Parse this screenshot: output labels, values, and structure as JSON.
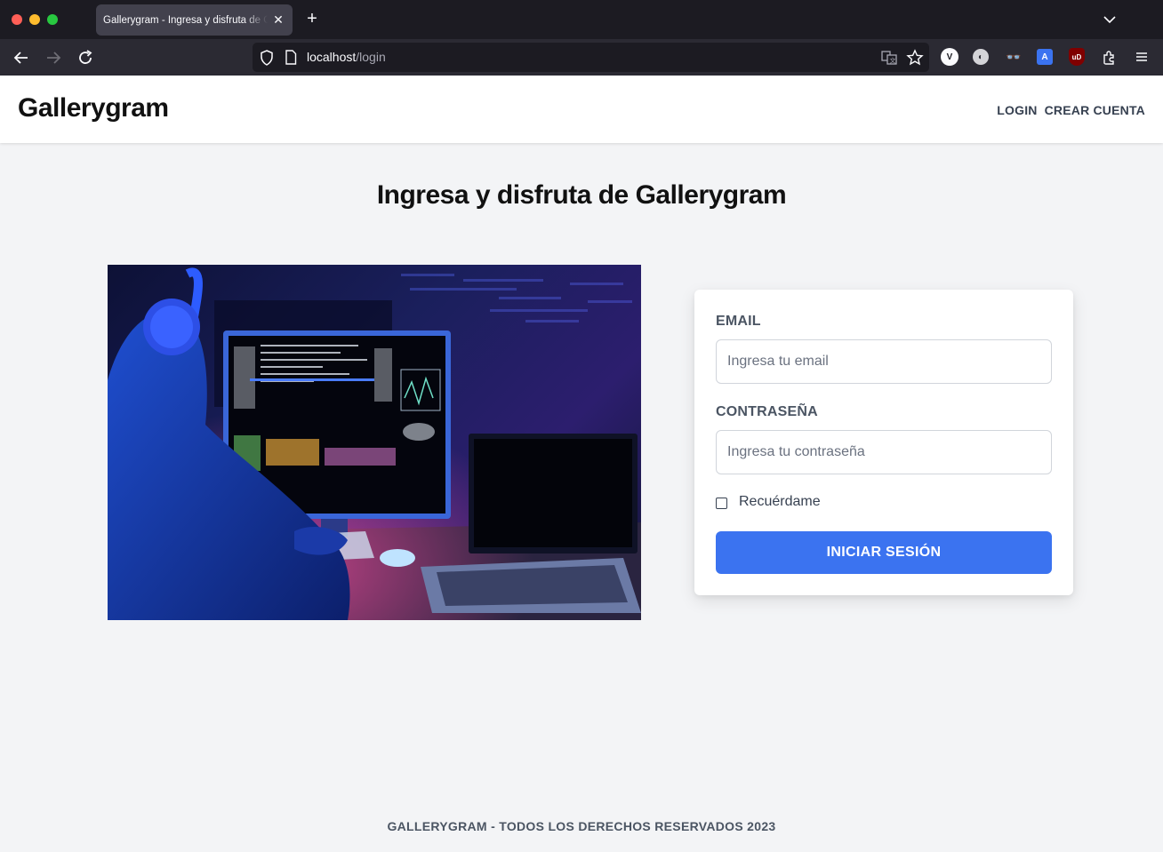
{
  "browser": {
    "tab_title": "Gallerygram - Ingresa y disfruta de Gallerygram",
    "url_host": "localhost",
    "url_path": "/login"
  },
  "header": {
    "brand": "Gallerygram",
    "nav": [
      {
        "label": "LOGIN"
      },
      {
        "label": "CREAR CUENTA"
      }
    ]
  },
  "main": {
    "headline": "Ingresa y disfruta de Gallerygram",
    "hero_image": "developer-at-computer-illustration"
  },
  "form": {
    "email_label": "EMAIL",
    "email_placeholder": "Ingresa tu email",
    "password_label": "CONTRASEÑA",
    "password_placeholder": "Ingresa tu contraseña",
    "remember_label": "Recuérdame",
    "remember_checked": false,
    "submit_label": "INICIAR SESIÓN"
  },
  "footer": {
    "text": "GALLERYGRAM - TODOS LOS DERECHOS RESERVADOS 2023"
  },
  "colors": {
    "accent": "#3b73f0",
    "page_bg": "#f3f4f6",
    "chrome_dark": "#1c1b22"
  }
}
